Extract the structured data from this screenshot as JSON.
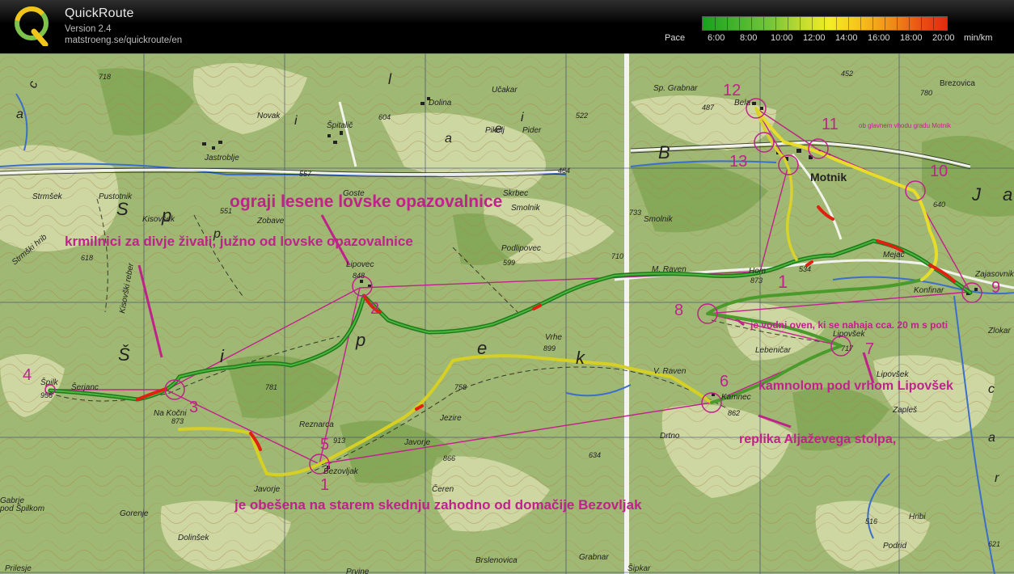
{
  "header": {
    "app_title": "QuickRoute",
    "version": "Version 2.4",
    "url": "matstroeng.se/quickroute/en",
    "pace_label": "Pace",
    "pace_ticks": [
      "6:00",
      "8:00",
      "10:00",
      "12:00",
      "14:00",
      "16:00",
      "18:00",
      "20:00"
    ],
    "pace_unit": "min/km"
  },
  "annotations": {
    "ograji": "ograji lesene lovske opazovalnice",
    "krmilnici": "krmilnici za divje živali, južno od lovske opazovalnice",
    "vodni": "je vodni oven, ki se nahaja cca. 20 m s poti",
    "kamnolom": "kamnolom pod vrhom Lipovšek",
    "replika": "replika Aljaževega stolpa,",
    "obesena": "je obešena na starem skednju zahodno od domačije Bezovljak",
    "motnik_small": "ob glavnem vhodu gradu Motnik"
  },
  "controls": [
    "1",
    "2",
    "3",
    "4",
    "5",
    "6",
    "7",
    "8",
    "9",
    "10",
    "11",
    "12",
    "13"
  ],
  "places": {
    "jastroblje": "Jastroblje",
    "spitalic": "Špitalič",
    "novak": "Novak",
    "dolina": "Dolina",
    "ucakar": "Učakar",
    "pikelj": "Pikelj",
    "pider": "Pider",
    "skrbec": "Skrbec",
    "smolnik": "Smolnik",
    "smolnik2": "Smolnik",
    "zobave": "Zobave",
    "goste": "Goste",
    "kisovsek": "Kisovšek",
    "pustotnik": "Pustotnik",
    "strmsek": "Strmšek",
    "strmski": "Strmški hrib",
    "kisovski": "Kisovški reber",
    "lipovec": "Lipovec",
    "podlipovec": "Podlipovec",
    "mraven": "M. Raven",
    "vraven": "V. Raven",
    "vrhe": "Vrhe",
    "hom": "Hom",
    "motnik": "Motnik",
    "bela": "Bela",
    "spgrabnar": "Sp. Grabnar",
    "brezovica": "Brezovica",
    "mejac": "Mejač",
    "konfinar": "Konfinar",
    "zajasovnik": "Zajasovnik",
    "lipovsek": "Lipovšek",
    "lebenicar": "Lebeničar",
    "kamnec": "Kamnec",
    "zaples": "Zapleš",
    "drtno": "Drtno",
    "hribi": "Hribi",
    "jezire": "Jezire",
    "javorje": "Javorje",
    "javorje2": "Javorje",
    "reznarca": "Reznarca",
    "bezovljak": "Bezovljak",
    "ceren": "Čeren",
    "serjanc": "Šerjanc",
    "nakocni": "Na Kočni",
    "spilk": "Špilk",
    "gabrje": "Gabrje",
    "podspilkom": "pod Špilkom",
    "gorenje": "Gorenje",
    "dolinsek": "Dolinšek",
    "prilesje": "Prilesje",
    "prvine": "Prvine",
    "breslenovica": "Brslenovica",
    "grabnar": "Grabnar",
    "sipkar": "Šipkar",
    "podrid": "Podrid",
    "zlokar": "Zlokar",
    "lipovsek2": "Lipovšek"
  },
  "elevations": {
    "e718": "718",
    "e604": "604",
    "e522": "522",
    "e557": "557",
    "e464": "464",
    "e551": "551",
    "e733": "733",
    "e618": "618",
    "e599": "599",
    "e710": "710",
    "e848": "848",
    "e899": "899",
    "e873": "873",
    "e534": "534",
    "e640": "640",
    "e452": "452",
    "e487": "487",
    "e717": "717",
    "e862": "862",
    "e956": "956",
    "e873b": "873",
    "e781": "781",
    "e758": "758",
    "e913": "913",
    "e866": "866",
    "e634": "634",
    "e780": "780",
    "e516": "516",
    "e621": "621"
  },
  "letters": {
    "l_s1": "S",
    "l_p1": "p",
    "l_i1": "i",
    "l_l1": "l",
    "l_s2": "Š",
    "l_p2": "p",
    "l_i2": "i",
    "l_e": "e",
    "l_k": "k",
    "l_b": "B",
    "l_j": "J",
    "l_a": "a",
    "l_a2": "a",
    "l_p3": "p",
    "l_i3": "i",
    "l_c1": "c",
    "l_a3": "a",
    "l_c2": "c",
    "l_a4": "a",
    "l_r": "r",
    "l_e2": "e"
  },
  "colors": {
    "annotation": "#c0228c",
    "route_fast": "#1e8a1e",
    "route_medium": "#e8e020",
    "route_slow": "#e02010",
    "terrain": "#a8be7a",
    "water": "#3c6ecc"
  }
}
